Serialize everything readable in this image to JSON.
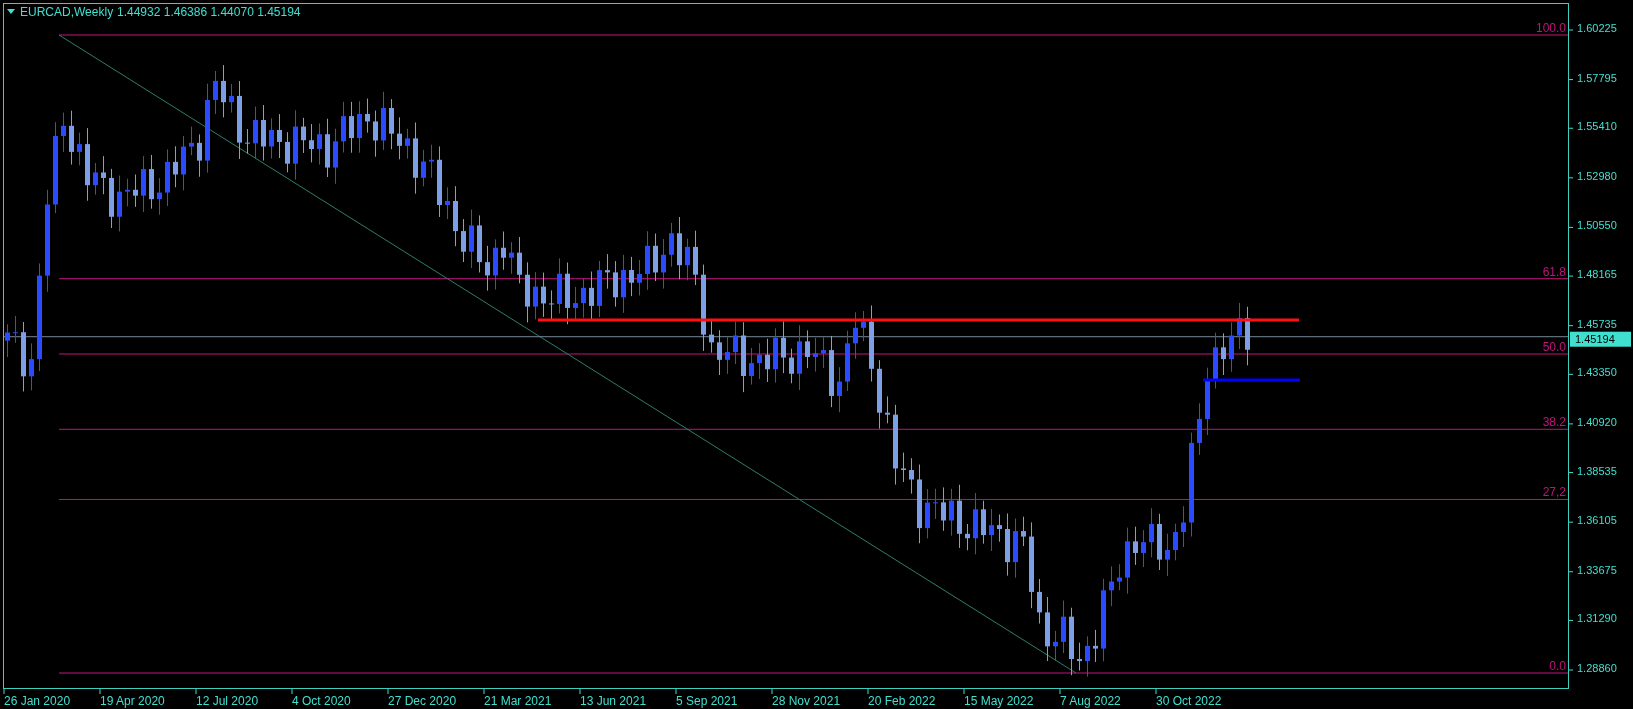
{
  "chart": {
    "title": "EURCAD,Weekly",
    "quotes": [
      "1.44932",
      "1.46386",
      "1.44070",
      "1.45194"
    ]
  },
  "price_axis": {
    "labels": [
      "1.60225",
      "1.57795",
      "1.55410",
      "1.52980",
      "1.50550",
      "1.48165",
      "1.45735",
      "1.43350",
      "1.40920",
      "1.38535",
      "1.36105",
      "1.33675",
      "1.31290",
      "1.28860"
    ],
    "current_price": "1.45194"
  },
  "fib_levels": [
    {
      "label": "100.0"
    },
    {
      "label": "61.8"
    },
    {
      "label": "50.0"
    },
    {
      "label": "38.2"
    },
    {
      "label": "27,2"
    },
    {
      "label": "0.0"
    }
  ],
  "time_axis": {
    "labels": [
      "26 Jan 2020",
      "19 Apr 2020",
      "12 Jul 2020",
      "4 Oct 2020",
      "27 Dec 2020",
      "21 Mar 2021",
      "13 Jun 2021",
      "5 Sep 2021",
      "28 Nov 2021",
      "20 Feb 2022",
      "15 May 2022",
      "7 Aug 2022",
      "30 Oct 2022"
    ]
  }
}
